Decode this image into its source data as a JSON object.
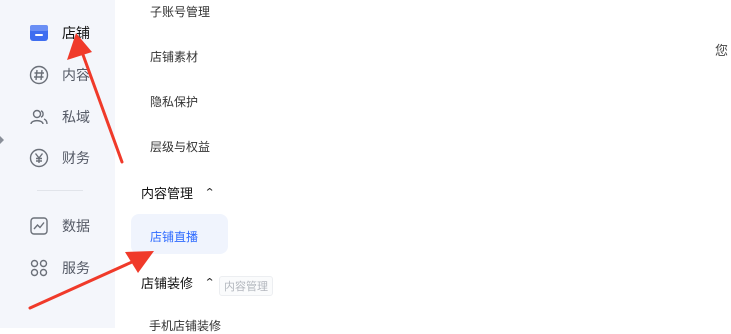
{
  "sidebar": {
    "items": [
      {
        "label": "店铺",
        "icon": "store-icon",
        "active": true
      },
      {
        "label": "内容",
        "icon": "hashtag-icon"
      },
      {
        "label": "私域",
        "icon": "users-icon"
      },
      {
        "label": "财务",
        "icon": "yuan-icon"
      },
      {
        "label": "数据",
        "icon": "chart-icon"
      },
      {
        "label": "服务",
        "icon": "grid-icon"
      }
    ]
  },
  "submenu": {
    "items_top": [
      "子账号管理",
      "店铺素材",
      "隐私保护",
      "层级与权益"
    ],
    "group_content": {
      "title": "内容管理",
      "chevron": "⌃"
    },
    "active_item": "店铺直播",
    "group_decor": {
      "title": "店铺装修",
      "chevron": "⌃"
    },
    "tooltip_ghost": "内容管理",
    "cutoff_item": "手机店铺装修"
  },
  "main": {
    "partial_text": "您"
  },
  "colors": {
    "accent": "#2f6bff",
    "arrow": "#f03a2a",
    "sidebar_bg": "#f4f6fb"
  }
}
